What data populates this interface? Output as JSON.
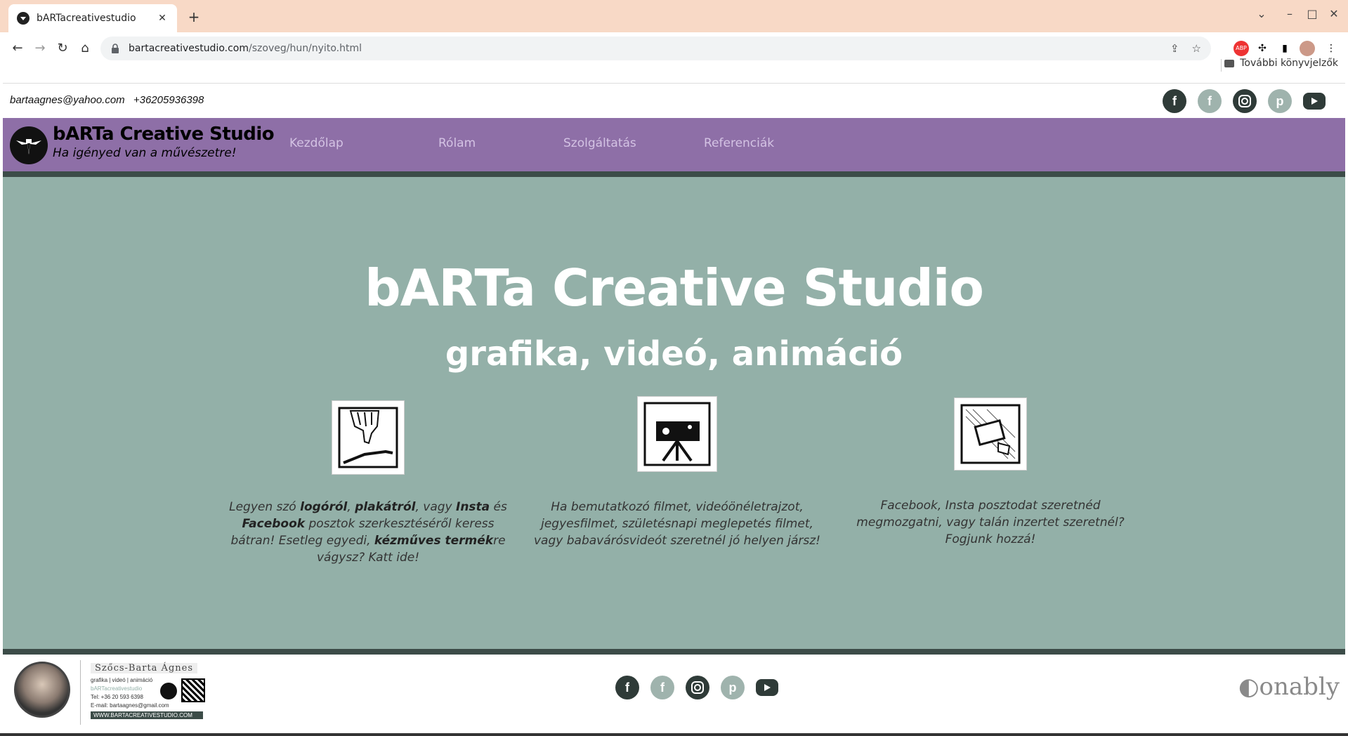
{
  "browser": {
    "tab_title": "bARTacreativestudio",
    "url_host": "bartacreativestudio.com",
    "url_path": "/szoveg/hun/nyito.html",
    "bookmarks_label": "További könyvjelzők"
  },
  "header": {
    "email": "bartaagnes@yahoo.com",
    "phone": "+36205936398",
    "social": [
      "facebook-icon",
      "facebook-icon",
      "instagram-icon",
      "pinterest-icon",
      "youtube-icon"
    ]
  },
  "nav": {
    "brand_title": "bARTa Creative Studio",
    "brand_subtitle": "Ha igényed van a művészetre!",
    "links": [
      "Kezdőlap",
      "Rólam",
      "Szolgáltatás",
      "Referenciák"
    ]
  },
  "hero": {
    "title": "bARTa Creative Studio",
    "subtitle": "grafika, videó, animáció"
  },
  "services": [
    {
      "parts": [
        "Legyen szó ",
        "logóról",
        ", ",
        "plakátról",
        ", vagy ",
        "Insta",
        " és ",
        "Facebook",
        " posztok szerkesztéséről keress bátran! Esetleg egyedi, ",
        "kézműves termék",
        "re vágysz? Katt ide!"
      ]
    },
    {
      "text": "Ha bemutatkozó filmet, videóönéletrajzot, jegyesfilmet, születésnapi meglepetés filmet, vagy babavárósvideót szeretnél jó helyen jársz!"
    },
    {
      "text": "Facebook, Insta posztodat szeretnéd megmozgatni, vagy talán inzertet szeretnél? Fogjunk hozzá!"
    }
  ],
  "footer": {
    "card_name": "Szőcs-Barta Ágnes",
    "card_tagline": "grafika | videó | animáció",
    "card_brand": "bARTacreativestudio",
    "card_tel": "Tel: +36 20 593 6398",
    "card_email": "E-mail: bartaagnes@gmail.com",
    "card_url": "WWW.BARTACREATIVESTUDIO.COM",
    "powered_by": "onably"
  }
}
